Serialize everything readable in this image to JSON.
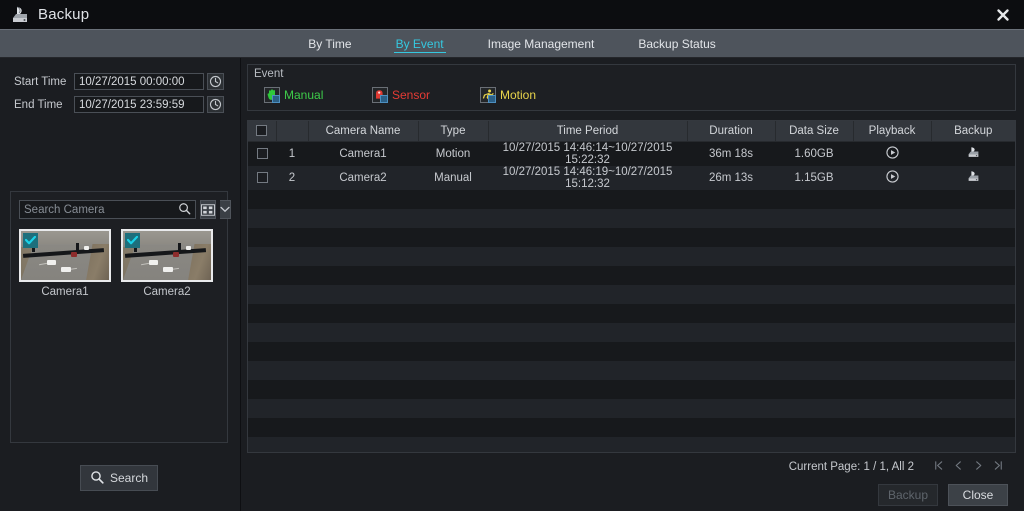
{
  "window": {
    "title": "Backup",
    "title_icon": "backup-disk-icon",
    "close_icon": "close-icon"
  },
  "tabs": [
    {
      "label": "By Time",
      "active": false
    },
    {
      "label": "By Event",
      "active": true
    },
    {
      "label": "Image Management",
      "active": false
    },
    {
      "label": "Backup Status",
      "active": false
    }
  ],
  "sidebar": {
    "start_time_label": "Start Time",
    "start_time_value": "10/27/2015 00:00:00",
    "end_time_label": "End Time",
    "end_time_value": "10/27/2015 23:59:59",
    "clock_icon": "clock-icon",
    "search_placeholder": "Search Camera",
    "search_value": "",
    "search_icon": "search-icon",
    "view_mode_icon": "grid-view-icon",
    "dropdown_icon": "chevron-down-icon",
    "cameras": [
      {
        "name": "Camera1",
        "selected": true
      },
      {
        "name": "Camera2",
        "selected": true
      }
    ],
    "search_button": "Search",
    "search_button_icon": "search-icon"
  },
  "event_panel": {
    "title": "Event",
    "types": [
      {
        "label": "Manual",
        "color": "#3ecb4a",
        "icon": "manual-hand-icon"
      },
      {
        "label": "Sensor",
        "color": "#e53b35",
        "icon": "sensor-icon"
      },
      {
        "label": "Motion",
        "color": "#e8d44b",
        "icon": "motion-person-icon"
      }
    ]
  },
  "table": {
    "columns": [
      "",
      "",
      "Camera Name",
      "Type",
      "Time Period",
      "Duration",
      "Data Size",
      "Playback",
      "Backup"
    ],
    "header_checkbox_checked": false,
    "rows": [
      {
        "checked": false,
        "index": "1",
        "camera_name": "Camera1",
        "type": "Motion",
        "type_class": "type-motion",
        "time_period": "10/27/2015 14:46:14~10/27/2015 15:22:32",
        "duration": "36m 18s",
        "data_size": "1.60GB",
        "playback_icon": "play-icon",
        "backup_icon": "backup-disk-icon"
      },
      {
        "checked": false,
        "index": "2",
        "camera_name": "Camera2",
        "type": "Manual",
        "type_class": "type-manual",
        "time_period": "10/27/2015 14:46:19~10/27/2015 15:12:32",
        "duration": "26m 13s",
        "data_size": "1.15GB",
        "playback_icon": "play-icon",
        "backup_icon": "backup-disk-icon"
      }
    ]
  },
  "footer": {
    "page_text": "Current Page: 1 / 1, All 2",
    "first_page_icon": "first-page-icon",
    "prev_page_icon": "prev-page-icon",
    "next_page_icon": "next-page-icon",
    "last_page_icon": "last-page-icon",
    "backup_button": "Backup",
    "backup_button_disabled": true,
    "close_button": "Close"
  },
  "colors": {
    "accent": "#35c8e0",
    "motion": "#e8d44b",
    "manual": "#3ecb4a",
    "sensor": "#e53b35",
    "window_bg": "#1b1d21",
    "tabbar_bg": "#4e545c"
  }
}
